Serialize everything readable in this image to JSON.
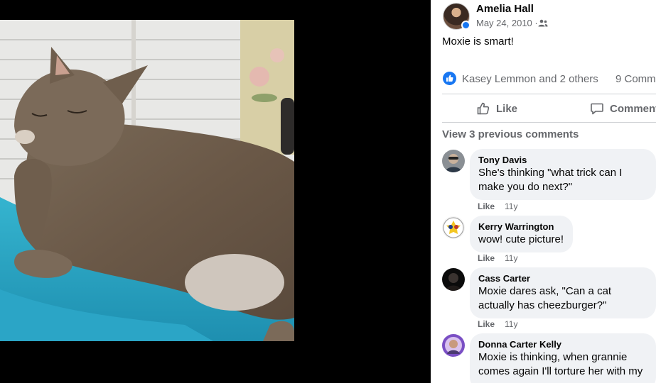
{
  "post": {
    "author": "Amelia Hall",
    "date": "May 24, 2010 · ",
    "text": "Moxie is smart!",
    "reactions_text": "Kasey Lemmon and 2 others",
    "comment_count": "9 Comm",
    "actions": {
      "like": "Like",
      "comment": "Comment"
    },
    "view_previous": "View 3 previous comments"
  },
  "comments": [
    {
      "name": "Tony Davis",
      "text": "She's thinking \"what trick can I make you do next?\"",
      "like": "Like",
      "time": "11y"
    },
    {
      "name": "Kerry Warrington",
      "text": "wow! cute picture!",
      "like": "Like",
      "time": "11y"
    },
    {
      "name": "Cass Carter",
      "text": "Moxie dares ask, \"Can a cat actually has cheezburger?\"",
      "like": "Like",
      "time": "11y"
    },
    {
      "name": "Donna Carter Kelly",
      "text": "Moxie is thinking, when grannie comes again I'll torture her with my"
    }
  ],
  "colors": {
    "accent": "#1877f2",
    "secondary_text": "#65676b",
    "bubble": "#f0f2f5"
  },
  "icons": [
    "audience-friends-icon",
    "like-reaction-icon",
    "thumbs-up-icon",
    "comment-bubble-icon"
  ]
}
